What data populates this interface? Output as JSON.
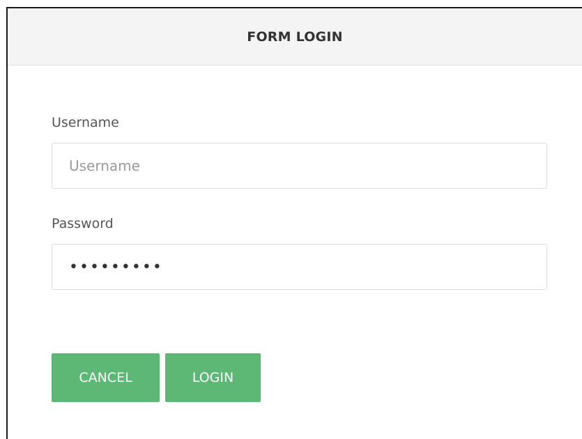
{
  "form": {
    "title": "FORM LOGIN",
    "username": {
      "label": "Username",
      "placeholder": "Username",
      "value": ""
    },
    "password": {
      "label": "Password",
      "value": "•••••••••"
    },
    "buttons": {
      "cancel_label": "CANCEL",
      "login_label": "LOGIN"
    }
  },
  "colors": {
    "button_green": "#5cb874",
    "header_background": "#f4f4f4"
  }
}
